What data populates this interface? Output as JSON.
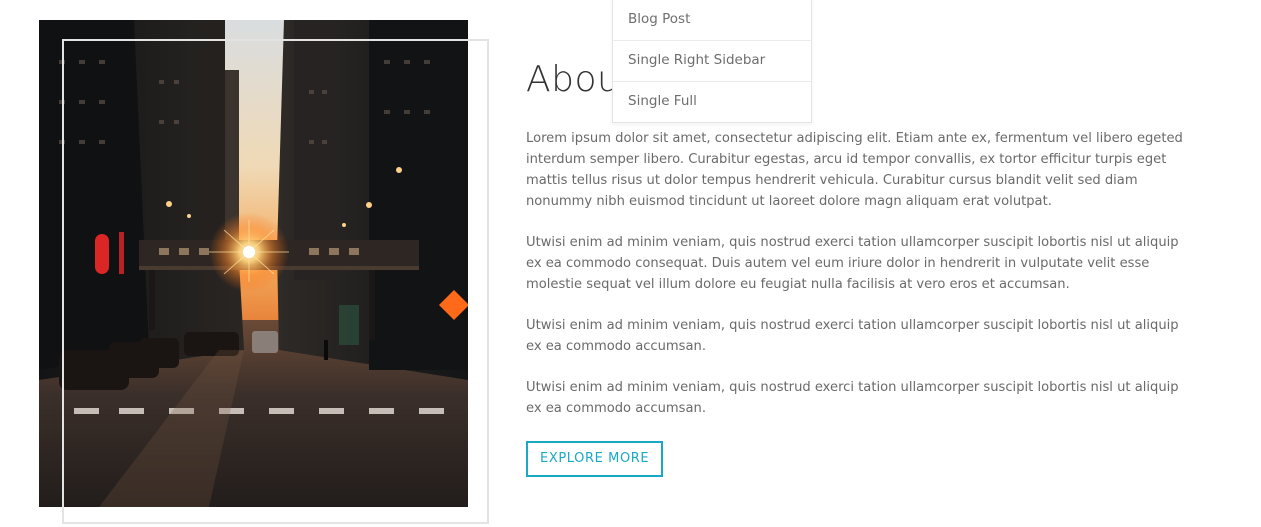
{
  "dropdown": {
    "items": [
      {
        "label": "Blog Post"
      },
      {
        "label": "Single Right Sidebar"
      },
      {
        "label": "Single Full"
      }
    ]
  },
  "about": {
    "title": "About",
    "paragraphs": [
      "Lorem ipsum dolor sit amet, consectetur adipiscing elit. Etiam ante ex, fermentum vel libero egeted interdum semper libero. Curabitur egestas, arcu id tempor convallis, ex tortor efficitur turpis eget mattis tellus risus ut dolor tempus hendrerit vehicula. Curabitur cursus blandit velit sed diam nonummy nibh euismod tincidunt ut laoreet dolore magn aliquam erat volutpat.",
      "Utwisi enim ad minim veniam, quis nostrud exerci tation ullamcorper suscipit lobortis nisl ut aliquip ex ea commodo consequat. Duis autem vel eum iriure dolor in hendrerit in vulputate velit esse molestie sequat vel illum dolore eu feugiat nulla facilisis at vero eros et accumsan.",
      "Utwisi enim ad minim veniam, quis nostrud exerci tation ullamcorper suscipit lobortis nisl ut aliquip ex ea commodo accumsan.",
      "Utwisi enim ad minim veniam, quis nostrud exerci tation ullamcorper suscipit lobortis nisl ut aliquip ex ea commodo accumsan."
    ],
    "button_label": "Explore More"
  },
  "colors": {
    "accent": "#19a9c6",
    "text": "#6a6a6a",
    "heading": "#333333"
  }
}
